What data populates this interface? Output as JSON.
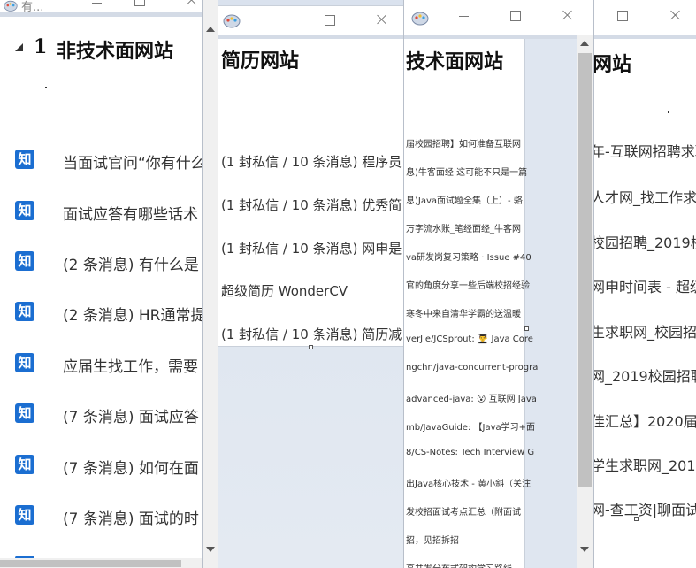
{
  "window1": {
    "title": "有...",
    "heading_number": "1",
    "heading": "非技术面网站",
    "items": [
      {
        "icon": "知",
        "text": "当面试官问“你有什么"
      },
      {
        "icon": "知",
        "text": "面试应答有哪些话术"
      },
      {
        "icon": "知",
        "text": "(2 条消息) 有什么是"
      },
      {
        "icon": "知",
        "text": "(2 条消息) HR通常提"
      },
      {
        "icon": "知",
        "text": "应届生找工作，需要"
      },
      {
        "icon": "知",
        "text": "(7 条消息) 面试应答"
      },
      {
        "icon": "知",
        "text": "(7 条消息) 如何在面"
      },
      {
        "icon": "知",
        "text": "(7 条消息) 面试的时"
      }
    ]
  },
  "window2": {
    "heading": "简历网站",
    "items": [
      "(1 封私信 / 10 条消息) 程序员",
      "(1 封私信 / 10 条消息) 优秀简",
      "(1 封私信 / 10 条消息) 网申是",
      "超级简历 WonderCV",
      "(1 封私信 / 10 条消息) 简历减"
    ]
  },
  "window3": {
    "heading": "技术面网站",
    "items": [
      "届校园招聘】如何准备互联网",
      "息)牛客面经 这可能不只是一篇",
      "息)Java面试题全集（上）- 骆",
      "万字流水账_笔经面经_牛客网",
      "va研发岗复习策略 · Issue #40",
      "官的角度分享一些后端校招经验",
      "寒冬中来自清华学霸的送温暖",
      "verJie/JCSprout: 👨‍🎓 Java Core",
      "ngchn/java-concurrent-progra",
      "advanced-java: 😮 互联网 Java",
      "mb/JavaGuide: 【Java学习+面",
      "8/CS-Notes: Tech Interview G",
      "出Java核心技术 - 黄小斜（关注",
      "发校招面试考点汇总（附面试",
      "招，见招拆招",
      "高并发分布式架构学习路线"
    ]
  },
  "window4": {
    "heading": "招聘网站",
    "heading_visible": "网站",
    "items": [
      "年-互联网招聘求职",
      "人才网_找工作求职",
      "校园招聘_2019校园",
      "网申时间表 - 超级",
      "生求职网_校园招聘",
      "网_2019校园招聘",
      "佳汇总】2020届校",
      "学生求职网_2019",
      "网-查工资|聊面试"
    ]
  }
}
